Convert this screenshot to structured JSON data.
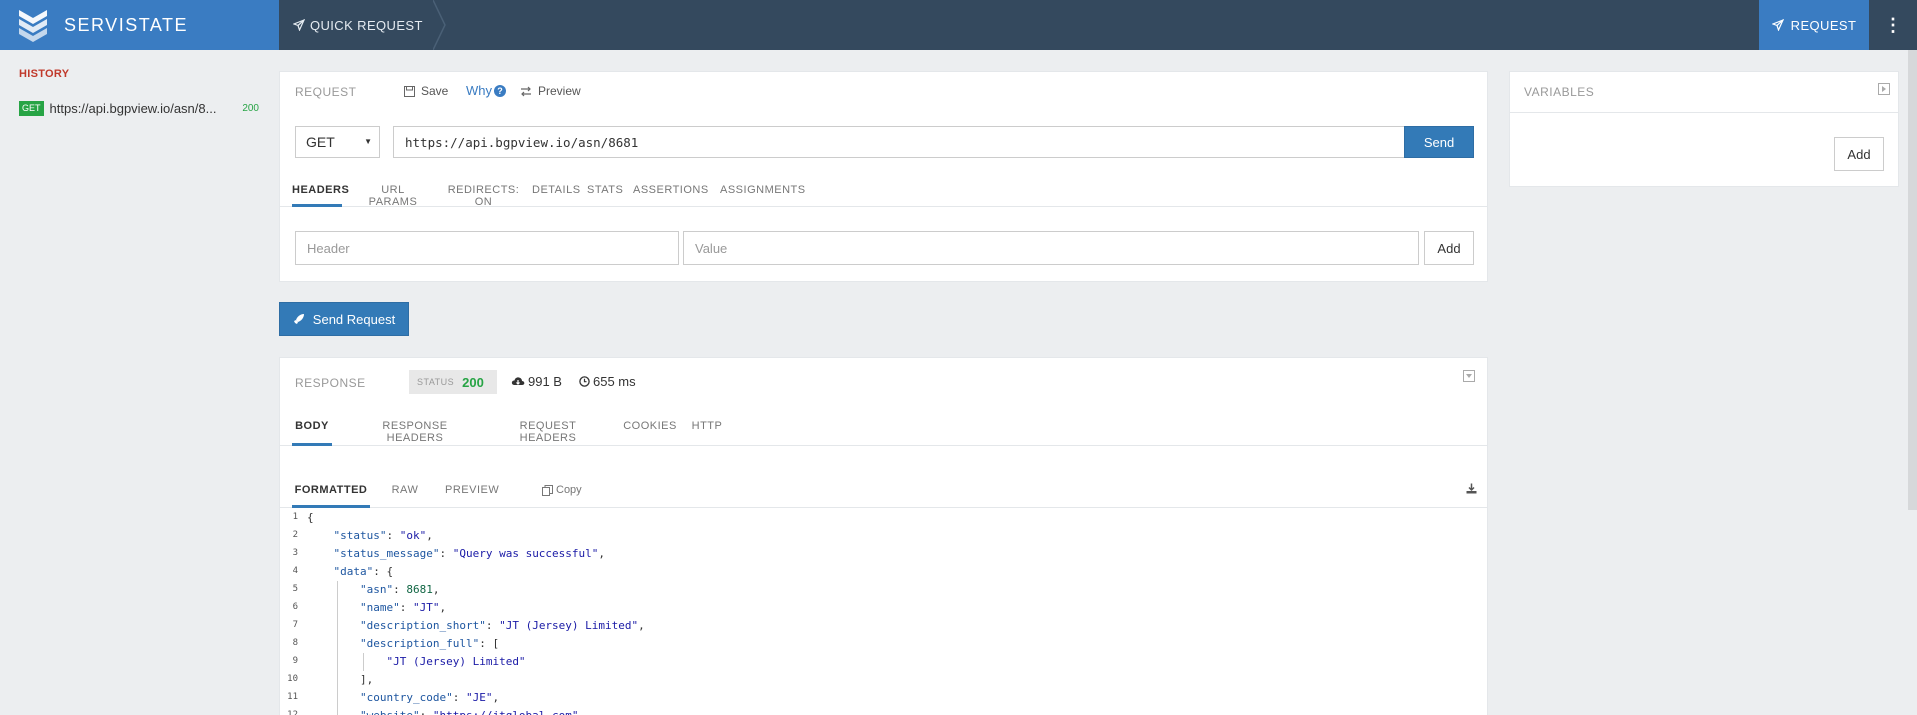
{
  "app": {
    "name": "SERVISTATE"
  },
  "topbar": {
    "quick_request_label": "QUICK REQUEST",
    "request_label": "REQUEST",
    "menu_glyph": "⋮"
  },
  "sidebar": {
    "history_title": "HISTORY",
    "items": [
      {
        "method": "GET",
        "url": "https://api.bgpview.io/asn/8...",
        "status": "200"
      }
    ]
  },
  "request": {
    "title": "REQUEST",
    "save_label": "Save",
    "why_label": "Why",
    "why_icon_glyph": "?",
    "preview_label": "Preview",
    "method": "GET",
    "url": "https://api.bgpview.io/asn/8681",
    "send_label": "Send",
    "tabs": [
      "HEADERS",
      "URL PARAMS",
      "REDIRECTS: ON",
      "DETAILS",
      "STATS",
      "ASSERTIONS",
      "ASSIGNMENTS"
    ],
    "active_tab": "HEADERS",
    "header_placeholder": "Header",
    "value_placeholder": "Value",
    "add_label": "Add"
  },
  "variables": {
    "title": "VARIABLES",
    "add_label": "Add"
  },
  "send_request_label": "Send Request",
  "response": {
    "title": "RESPONSE",
    "status_label": "STATUS",
    "status_code": "200",
    "size": "991 B",
    "time": "655 ms",
    "tabs": [
      "BODY",
      "RESPONSE HEADERS",
      "REQUEST HEADERS",
      "COOKIES",
      "HTTP"
    ],
    "active_tab": "BODY",
    "body_tabs": [
      "FORMATTED",
      "RAW",
      "PREVIEW"
    ],
    "active_body_tab": "FORMATTED",
    "copy_label": "Copy",
    "code_lines": [
      "{",
      "    \"status\": \"ok\",",
      "    \"status_message\": \"Query was successful\",",
      "    \"data\": {",
      "        \"asn\": 8681,",
      "        \"name\": \"JT\",",
      "        \"description_short\": \"JT (Jersey) Limited\",",
      "        \"description_full\": [",
      "            \"JT (Jersey) Limited\"",
      "        ],",
      "        \"country_code\": \"JE\",",
      "        \"website\": \"https://jtglobal.com\","
    ]
  },
  "colors": {
    "brand": "#3a7cc2",
    "navbar": "#34495e",
    "primary_button": "#337ab7",
    "success": "#27a445",
    "history_title": "#c0392b"
  },
  "icons": [
    "servistate-logo-icon",
    "paper-plane-icon",
    "save-icon",
    "question-circle-icon",
    "exchange-icon",
    "rocket-icon",
    "cloud-download-icon",
    "clock-icon",
    "copy-icon",
    "download-icon",
    "collapse-icon",
    "kebab-menu-icon"
  ]
}
